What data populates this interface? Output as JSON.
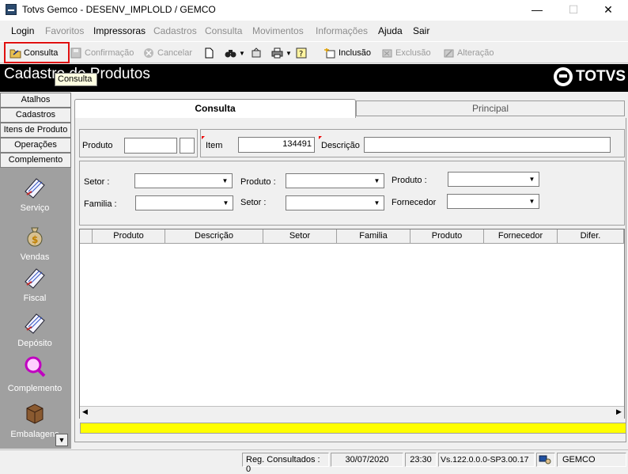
{
  "window": {
    "title": "Totvs Gemco - DESENV_IMPLOLD / GEMCO",
    "minimize": "—",
    "maximize": "☐",
    "close": "✕"
  },
  "menu": [
    {
      "label": "Login",
      "enabled": true
    },
    {
      "label": "Favoritos",
      "enabled": false
    },
    {
      "label": "Impressoras",
      "enabled": true
    },
    {
      "label": "Cadastros",
      "enabled": false
    },
    {
      "label": "Consulta",
      "enabled": false
    },
    {
      "label": "Movimentos",
      "enabled": false
    },
    {
      "label": "Informações",
      "enabled": false
    },
    {
      "label": "Ajuda",
      "enabled": true
    },
    {
      "label": "Sair",
      "enabled": true
    }
  ],
  "toolbar": {
    "consulta": "Consulta",
    "confirmacao": "Confirmação",
    "cancelar": "Cancelar",
    "inclusao": "Inclusão",
    "exclusao": "Exclusão",
    "alteracao": "Alteração",
    "tooltip": "Consulta"
  },
  "header": {
    "form_title": "Cadastro de Produtos",
    "brand": "TOTVS"
  },
  "sidebar": {
    "buttons": [
      "Atalhos",
      "Cadastros",
      "Itens de Produto",
      "Operações",
      "Complemento"
    ],
    "items": [
      "Serviço",
      "Vendas",
      "Fiscal",
      "Depósito",
      "Complemento",
      "Embalagens"
    ]
  },
  "tabs": {
    "active": "Consulta",
    "inactive": "Principal"
  },
  "fields": {
    "produto_label": "Produto",
    "item_label": "Item",
    "item_value": "134491",
    "descricao_label": "Descrição"
  },
  "filters": {
    "setor1": "Setor :",
    "produto1": "Produto :",
    "produto2": "Produto :",
    "familia": "Familia :",
    "setor2": "Setor :",
    "fornecedor": "Fornecedor"
  },
  "grid": {
    "columns": [
      "Produto",
      "Descrição",
      "Setor",
      "Familia",
      "Produto",
      "Fornecedor",
      "Difer."
    ]
  },
  "status": {
    "reg": "Reg. Consultados : 0",
    "date": "30/07/2020",
    "time": "23:30",
    "version": "Vs.122.0.0.0-SP3.00.17",
    "env": "GEMCO"
  },
  "colors": {
    "highlight": "#e01010",
    "tooltip_bg": "#ffffe1",
    "yellow_bar": "#ffff00",
    "header_band": "#000000"
  }
}
